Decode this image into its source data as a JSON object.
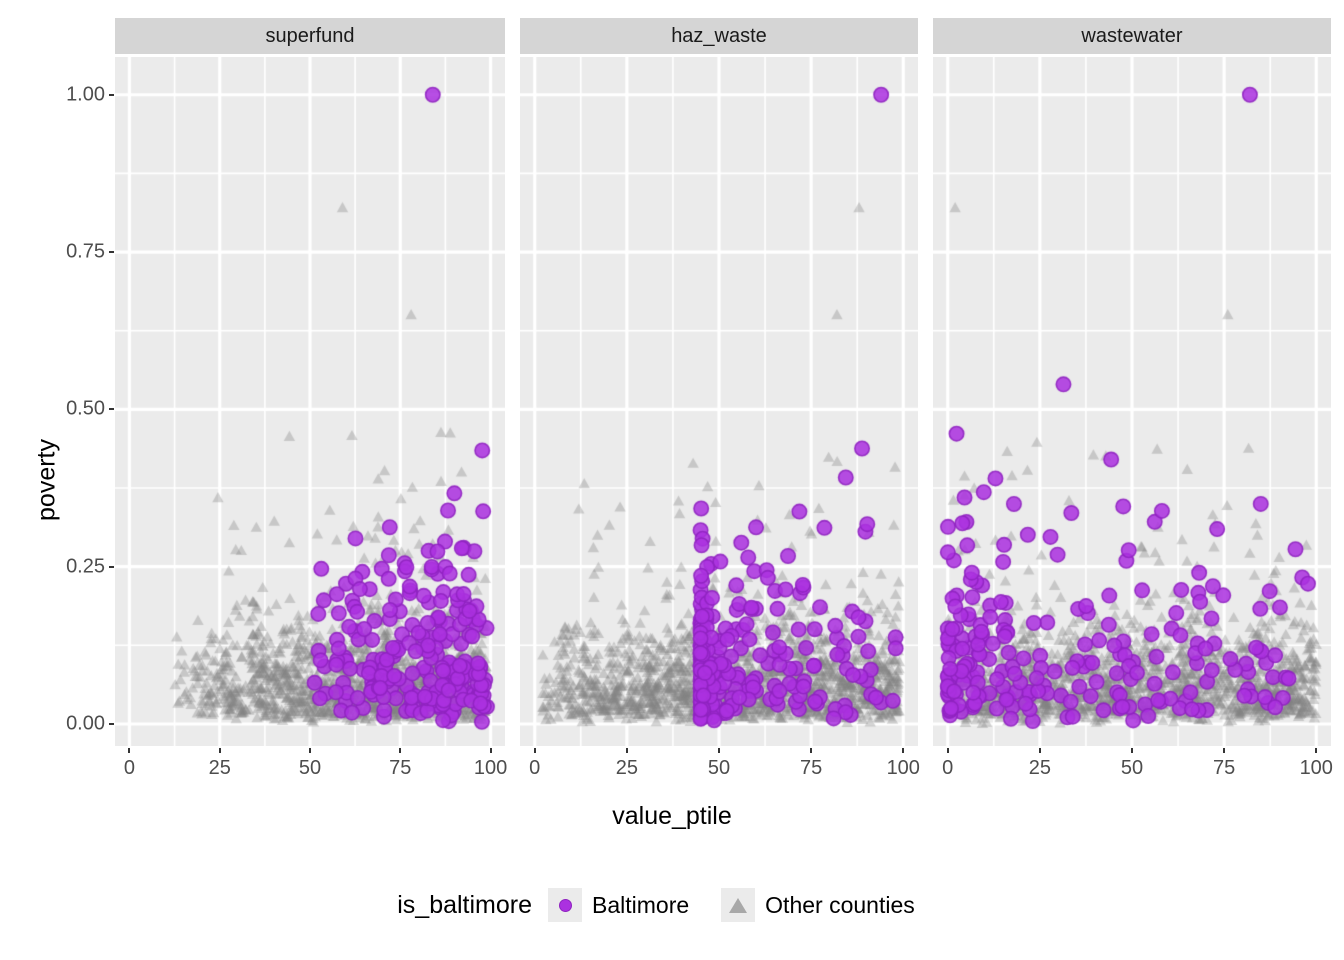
{
  "chart_data": {
    "type": "scatter",
    "title": "",
    "xlabel": "value_ptile",
    "ylabel": "poverty",
    "xlim": [
      -4,
      104
    ],
    "ylim": [
      -0.035,
      1.06
    ],
    "xticks": [
      0,
      25,
      50,
      75,
      100
    ],
    "xticklabels": [
      "0",
      "25",
      "50",
      "75",
      "100"
    ],
    "yticks": [
      0.0,
      0.25,
      0.5,
      0.75,
      1.0
    ],
    "yticklabels": [
      "0.00",
      "0.25",
      "0.50",
      "0.75",
      "1.00"
    ],
    "grid": true,
    "minor_grid": true,
    "facet_variable": "",
    "facets": [
      "superfund",
      "haz_waste",
      "wastewater"
    ],
    "legend": {
      "title": "is_baltimore",
      "position": "bottom",
      "entries": [
        {
          "label": "Baltimore",
          "shape": "circle",
          "color": "#AB31E0"
        },
        {
          "label": "Other counties",
          "shape": "triangle",
          "color": "#A8A8A8"
        }
      ]
    },
    "series": [
      {
        "name": "Baltimore",
        "shape": "circle",
        "color": "#AB31E0",
        "alpha": 0.85,
        "n_points": 230,
        "facet_distributions": {
          "superfund": {
            "x_mode": "high-skew",
            "x_min": 51,
            "x_max": 99,
            "y_range": [
              0.01,
              1.0
            ]
          },
          "haz_waste": {
            "x_mode": "very-high-skew",
            "x_min": 45,
            "x_max": 100,
            "y_range": [
              0.01,
              1.0
            ]
          },
          "wastewater": {
            "x_mode": "low-skew",
            "x_min": 0,
            "x_max": 98,
            "y_range": [
              0.01,
              1.0
            ]
          }
        }
      },
      {
        "name": "Other counties",
        "shape": "triangle",
        "color": "#808080",
        "alpha": 0.35,
        "n_points": 1500,
        "facet_distributions": {
          "superfund": {
            "x_mode": "mid-high",
            "x_min": 12,
            "x_max": 99,
            "y_range": [
              0.0,
              0.82
            ]
          },
          "haz_waste": {
            "x_mode": "uniform-wide",
            "x_min": 2,
            "x_max": 100,
            "y_range": [
              0.0,
              0.82
            ]
          },
          "wastewater": {
            "x_mode": "uniform",
            "x_min": 0,
            "x_max": 100,
            "y_range": [
              0.0,
              0.82
            ]
          }
        }
      }
    ],
    "notable_points": [
      {
        "facet": "superfund",
        "series": "Baltimore",
        "x": 84,
        "y": 1.0
      },
      {
        "facet": "superfund",
        "series": "Other counties",
        "x": 59,
        "y": 0.82
      },
      {
        "facet": "superfund",
        "series": "Other counties",
        "x": 78,
        "y": 0.65
      },
      {
        "facet": "haz_waste",
        "series": "Baltimore",
        "x": 94,
        "y": 1.0
      },
      {
        "facet": "haz_waste",
        "series": "Other counties",
        "x": 88,
        "y": 0.82
      },
      {
        "facet": "haz_waste",
        "series": "Other counties",
        "x": 82,
        "y": 0.65
      },
      {
        "facet": "wastewater",
        "series": "Baltimore",
        "x": 82,
        "y": 1.0
      },
      {
        "facet": "wastewater",
        "series": "Other counties",
        "x": 2,
        "y": 0.82
      },
      {
        "facet": "wastewater",
        "series": "Other counties",
        "x": 76,
        "y": 0.65
      }
    ]
  },
  "theme": {
    "panel_background": "#EBEBEB",
    "gridline_major": "#FFFFFF",
    "gridline_minor": "#FFFFFF",
    "strip_background": "#D5D5D5",
    "plot_background": "#FFFFFF",
    "axis_text_color": "#4D4D4D",
    "axis_title_color": "#000000"
  }
}
